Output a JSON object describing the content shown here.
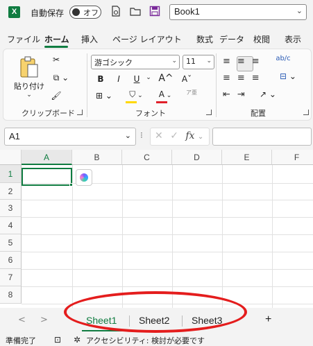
{
  "titlebar": {
    "app_logo": "X",
    "autosave_label": "自動保存",
    "autosave_state": "オフ",
    "book_name": "Book1",
    "icons": [
      "excel-icon",
      "document-icon",
      "folder-icon",
      "save-icon"
    ]
  },
  "menu": {
    "items": [
      "ファイル",
      "ホーム",
      "挿入",
      "ページ レイアウト",
      "数式",
      "データ",
      "校閲",
      "表示"
    ],
    "active": "ホーム"
  },
  "ribbon": {
    "clipboard": {
      "paste_label": "貼り付け",
      "group_label": "クリップボード"
    },
    "font": {
      "font_name": "游ゴシック",
      "font_size": "11",
      "bold": "B",
      "italic": "I",
      "underline": "U",
      "grow": "A^",
      "shrink": "Aˇ",
      "font_color": "A",
      "phonetic": "ア亜",
      "group_label": "フォント"
    },
    "alignment": {
      "wrap": "ab/c",
      "group_label": "配置"
    },
    "accent_color": "#107c41"
  },
  "formula_bar": {
    "name_box": "A1",
    "fx": "fx",
    "formula": ""
  },
  "grid": {
    "columns": [
      "A",
      "B",
      "C",
      "D",
      "E",
      "F"
    ],
    "rows": [
      "1",
      "2",
      "3",
      "4",
      "5",
      "6",
      "7",
      "8"
    ],
    "selected_cell": "A1"
  },
  "sheets": {
    "tabs": [
      "Sheet1",
      "Sheet2",
      "Sheet3"
    ],
    "active": "Sheet1",
    "add_label": "+",
    "prev_label": "<",
    "next_label": ">",
    "highlight_color": "#e41d1d"
  },
  "status": {
    "ready": "準備完了",
    "accessibility": "アクセシビリティ: 検討が必要です"
  }
}
